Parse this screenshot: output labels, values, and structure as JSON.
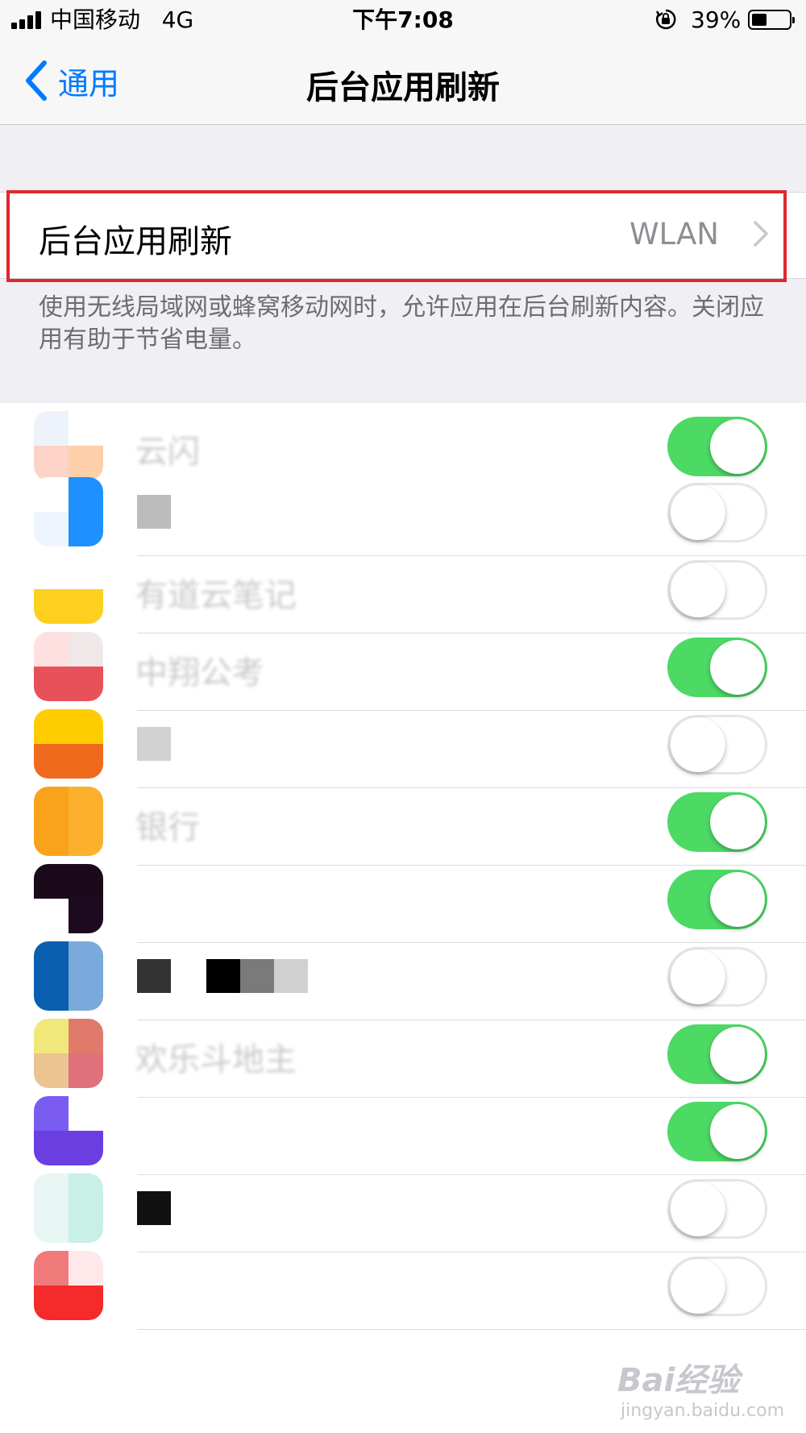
{
  "status_bar": {
    "carrier": "中国移动",
    "network": "4G",
    "time": "下午7:08",
    "battery_percent": "39%",
    "battery_level": 0.39
  },
  "nav": {
    "back_label": "通用",
    "title": "后台应用刷新"
  },
  "refresh_setting": {
    "label": "后台应用刷新",
    "value": "WLAN"
  },
  "footer_note": "使用无线局域网或蜂窝移动网时，允许应用在后台刷新内容。关闭应用有助于节省电量。",
  "colors": {
    "accent": "#007aff",
    "toggle_on": "#4cd964",
    "highlight": "#e0282e"
  },
  "apps": [
    {
      "name": "云闪",
      "on": true
    },
    {
      "name": "",
      "on": false
    },
    {
      "name": "有道云笔记",
      "on": false
    },
    {
      "name": "中翔公考",
      "on": true
    },
    {
      "name": "",
      "on": false
    },
    {
      "name": "银行",
      "on": true
    },
    {
      "name": "",
      "on": true
    },
    {
      "name": "",
      "on": false
    },
    {
      "name": "欢乐斗地主",
      "on": true
    },
    {
      "name": "",
      "on": true
    },
    {
      "name": "",
      "on": false
    },
    {
      "name": "",
      "on": false
    }
  ],
  "watermark": {
    "logo": "Bai经验",
    "url": "jingyan.baidu.com"
  }
}
